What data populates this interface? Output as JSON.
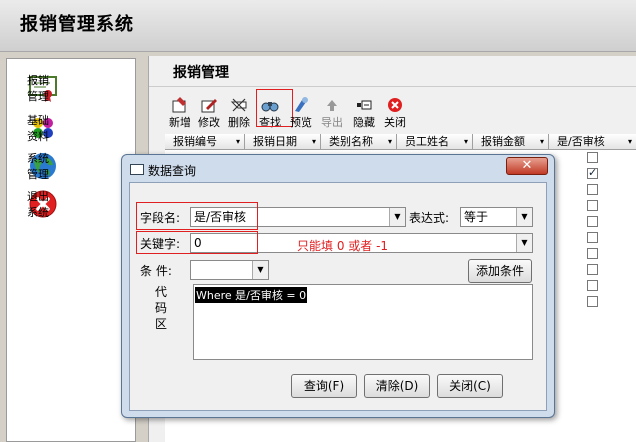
{
  "app_title": "报销管理系统",
  "sidebar": {
    "items": [
      {
        "label": "报销管理",
        "icon": "certificate-icon"
      },
      {
        "label": "基础资料",
        "icon": "balls-icon"
      },
      {
        "label": "系统管理",
        "icon": "globe-icon"
      },
      {
        "label": "退出系统",
        "icon": "exit-icon"
      }
    ]
  },
  "main": {
    "title": "报销管理",
    "toolbar": {
      "add": "新增",
      "edit": "修改",
      "delete": "删除",
      "find": "查找",
      "preview": "预览",
      "export": "导出",
      "hide": "隐藏",
      "close": "关闭"
    },
    "grid": {
      "columns": [
        "报销编号",
        "报销日期",
        "类别名称",
        "员工姓名",
        "报销金额",
        "是/否审核"
      ],
      "checkbox_states": [
        false,
        true,
        false,
        false,
        false,
        false,
        false,
        false,
        false,
        false
      ]
    }
  },
  "dialog": {
    "title": "数据查询",
    "field_label": "字段名:",
    "field_value": "是/否审核",
    "expr_label": "表达式:",
    "expr_value": "等于",
    "keyword_label": "关键字:",
    "keyword_value": "0",
    "hint": "只能填 0 或者 -1",
    "condition_label": "条  件:",
    "condition_value": "",
    "add_condition": "添加条件",
    "code_label": "代码区",
    "code_value": "Where 是/否审核 = 0",
    "query_button": "查询(F)",
    "clear_button": "清除(D)",
    "close_button": "关闭(C)"
  }
}
